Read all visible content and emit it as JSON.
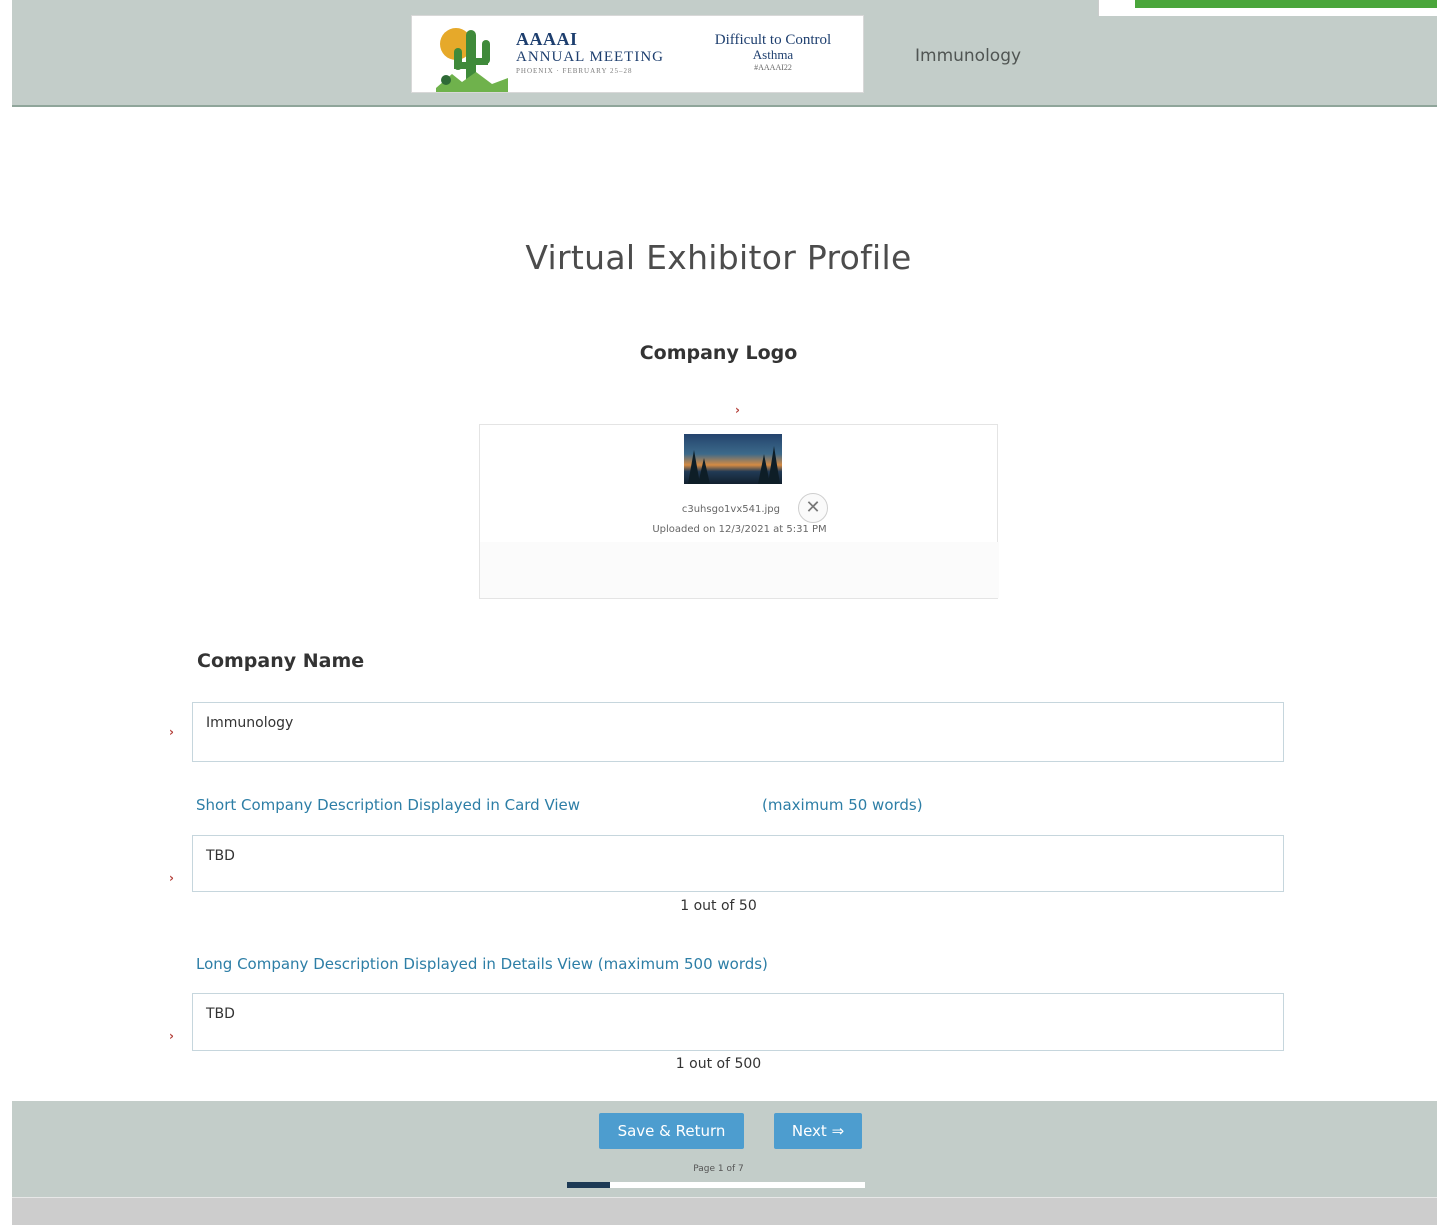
{
  "header": {
    "banner": {
      "org_mark": "AAAAI",
      "meeting_title": "ANNUAL MEETING",
      "meeting_sub": "PHOENIX · FEBRUARY 25–28",
      "session_line1": "Difficult to Control",
      "session_line2": "Asthma",
      "session_line3": "#AAAAI22"
    },
    "title": "Immunology"
  },
  "page_title": "Virtual Exhibitor Profile",
  "logo_section": {
    "label": "Company Logo",
    "file_name": "c3uhsgo1vx541.jpg",
    "uploaded_text": "Uploaded on 12/3/2021 at 5:31 PM",
    "remove_symbol": "✕"
  },
  "company_name": {
    "label": "Company Name",
    "value": "Immunology"
  },
  "short_description": {
    "label": "Short Company Description Displayed in Card View",
    "limit_text": "(maximum 50 words)",
    "value": "TBD",
    "counter": "1 out of 50"
  },
  "long_description": {
    "label": "Long Company Description Displayed in Details View (maximum 500 words)",
    "value": "TBD",
    "counter": "1 out of 500"
  },
  "required_symbol": "›",
  "footer": {
    "save_label": "Save & Return",
    "next_label": "Next ⇒",
    "page_info": "Page 1 of 7",
    "progress_fraction": 0.143
  },
  "colors": {
    "header_bg": "#c3cdc9",
    "button_bg": "#4d9dcf",
    "label_blue": "#2d7ea6",
    "required_red": "#b4403a",
    "progress_fill": "#1d3a55",
    "accent_green": "#4aa63b"
  }
}
